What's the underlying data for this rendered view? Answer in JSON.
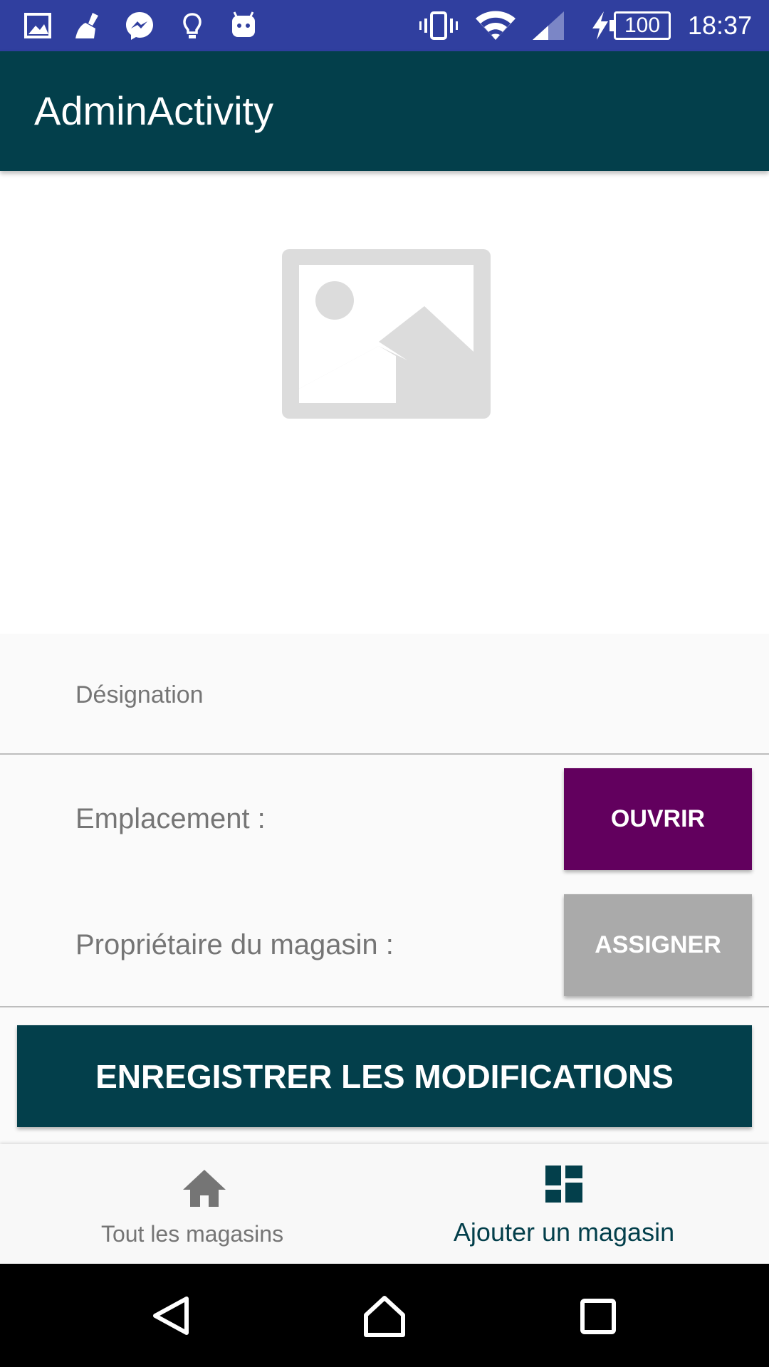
{
  "status_bar": {
    "time": "18:37",
    "battery_level": "100",
    "background_color": "#303f9f",
    "icons": [
      "gallery-icon",
      "broom-icon",
      "messenger-icon",
      "lightbulb-icon",
      "android-icon",
      "vibrate-icon",
      "wifi-icon",
      "signal-icon",
      "charging-icon",
      "battery-icon"
    ]
  },
  "app_bar": {
    "title": "AdminActivity",
    "background_color": "#033f4b"
  },
  "image": {
    "icon": "image-placeholder-icon"
  },
  "form": {
    "designation_placeholder": "Désignation",
    "location_label": "Emplacement :",
    "open_button_label": "OUVRIR",
    "open_button_color": "#62005e",
    "owner_label": "Propriétaire du magasin :",
    "assign_button_label": "ASSIGNER",
    "assign_button_color": "#aaaaaa",
    "save_button_label": "ENREGISTRER LES MODIFICATIONS",
    "save_button_color": "#033f4b"
  },
  "bottom_nav": {
    "items": [
      {
        "label": "Tout les magasins",
        "icon": "home-icon",
        "active": false
      },
      {
        "label": "Ajouter un magasin",
        "icon": "dashboard-icon",
        "active": true
      }
    ],
    "active_color": "#033f4b",
    "inactive_color": "#757575"
  },
  "system_nav": {
    "icons": [
      "back-icon",
      "home-icon",
      "recents-icon"
    ]
  }
}
